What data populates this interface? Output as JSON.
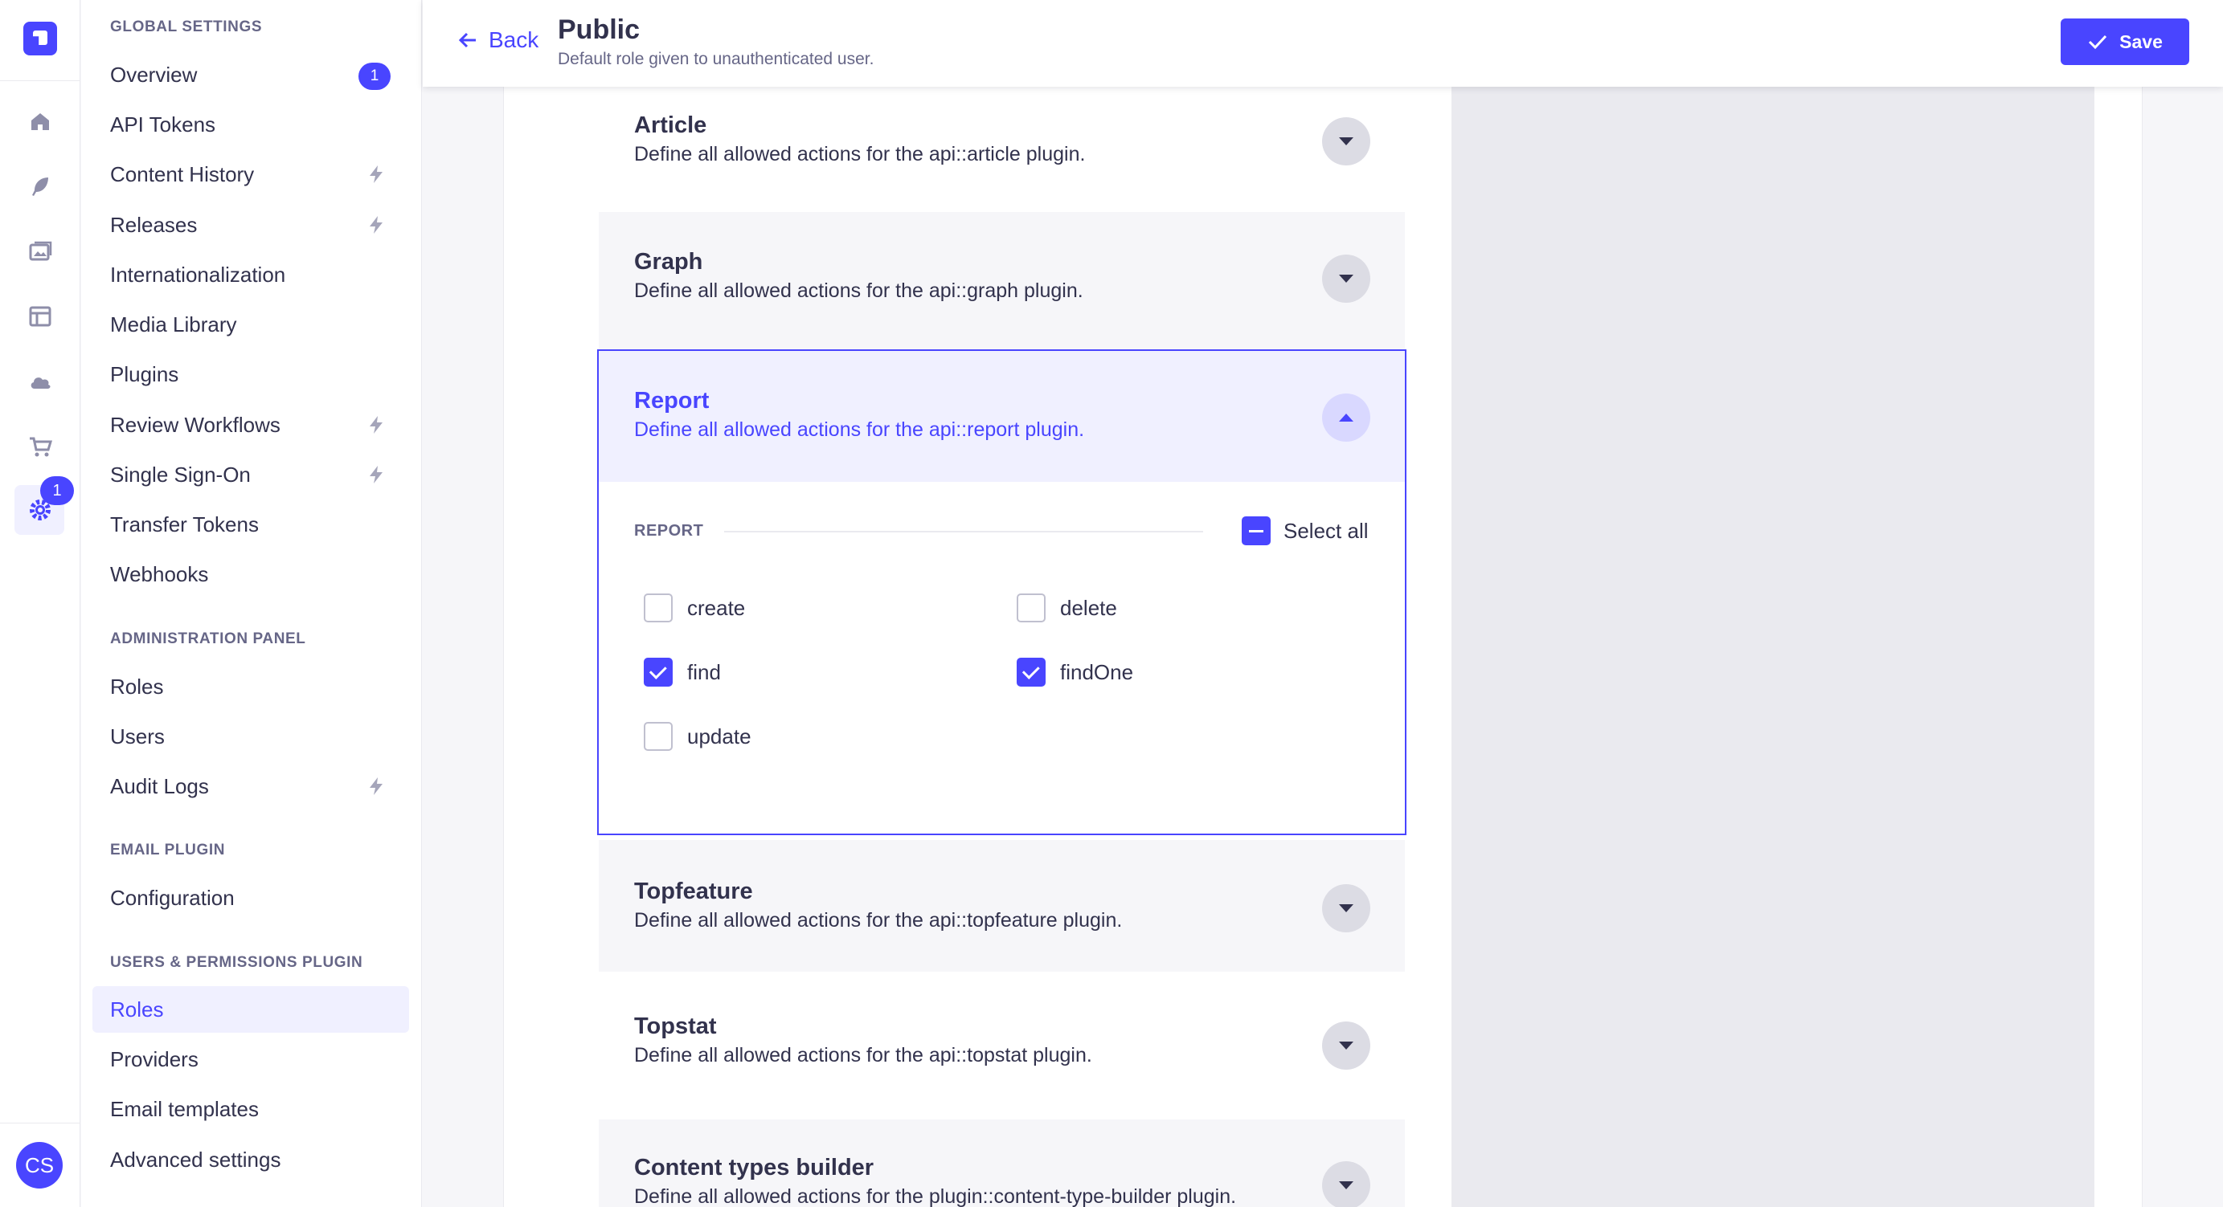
{
  "rail": {
    "badge": "1",
    "avatar_initials": "CS",
    "icons": [
      "home-icon",
      "feather-icon",
      "media-icon",
      "layout-icon",
      "cloud-icon",
      "cart-icon",
      "settings-icon"
    ]
  },
  "sidenav": {
    "sections": [
      {
        "title": "GLOBAL SETTINGS",
        "items": [
          {
            "label": "Overview",
            "badge": "1"
          },
          {
            "label": "API Tokens"
          },
          {
            "label": "Content History",
            "icon": "bolt-icon"
          },
          {
            "label": "Releases",
            "icon": "bolt-icon"
          },
          {
            "label": "Internationalization"
          },
          {
            "label": "Media Library"
          },
          {
            "label": "Plugins"
          },
          {
            "label": "Review Workflows",
            "icon": "bolt-icon"
          },
          {
            "label": "Single Sign-On",
            "icon": "bolt-icon"
          },
          {
            "label": "Transfer Tokens"
          },
          {
            "label": "Webhooks"
          }
        ]
      },
      {
        "title": "ADMINISTRATION PANEL",
        "items": [
          {
            "label": "Roles"
          },
          {
            "label": "Users"
          },
          {
            "label": "Audit Logs",
            "icon": "bolt-icon"
          }
        ]
      },
      {
        "title": "EMAIL PLUGIN",
        "items": [
          {
            "label": "Configuration"
          }
        ]
      },
      {
        "title": "USERS & PERMISSIONS PLUGIN",
        "items": [
          {
            "label": "Roles",
            "active": true
          },
          {
            "label": "Providers"
          },
          {
            "label": "Email templates"
          },
          {
            "label": "Advanced settings"
          }
        ]
      }
    ]
  },
  "header": {
    "back_label": "Back",
    "title": "Public",
    "subtitle": "Default role given to unauthenticated user.",
    "save_label": "Save"
  },
  "accordions": [
    {
      "title": "Article",
      "desc": "Define all allowed actions for the api::article plugin."
    },
    {
      "title": "Graph",
      "desc": "Define all allowed actions for the api::graph plugin."
    },
    {
      "title": "Report",
      "desc": "Define all allowed actions for the api::report plugin.",
      "expanded": true,
      "group_label": "REPORT",
      "select_all_label": "Select all",
      "permissions": [
        {
          "label": "create",
          "checked": false
        },
        {
          "label": "delete",
          "checked": false
        },
        {
          "label": "find",
          "checked": true
        },
        {
          "label": "findOne",
          "checked": true
        },
        {
          "label": "update",
          "checked": false
        }
      ]
    },
    {
      "title": "Topfeature",
      "desc": "Define all allowed actions for the api::topfeature plugin."
    },
    {
      "title": "Topstat",
      "desc": "Define all allowed actions for the api::topstat plugin."
    },
    {
      "title": "Content types builder",
      "desc": "Define all allowed actions for the plugin::content-type-builder plugin."
    }
  ],
  "colors": {
    "accent": "#4945ff",
    "text": "#32324d",
    "muted": "#666687"
  }
}
